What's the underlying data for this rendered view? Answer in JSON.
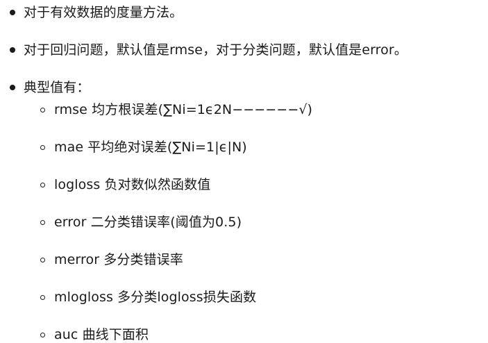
{
  "list": {
    "items": [
      "对于有效数据的度量方法。",
      "对于回归问题，默认值是rmse，对于分类问题，默认值是error。",
      "典型值有："
    ],
    "sub_items": [
      "rmse 均方根误差(∑Ni=1ϵ2N−−−−−−√)",
      "mae 平均绝对误差(∑Ni=1|ϵ|N)",
      "logloss 负对数似然函数值",
      "error 二分类错误率(阈值为0.5)",
      "merror 多分类错误率",
      "mlogloss 多分类logloss损失函数",
      "auc 曲线下面积"
    ]
  }
}
